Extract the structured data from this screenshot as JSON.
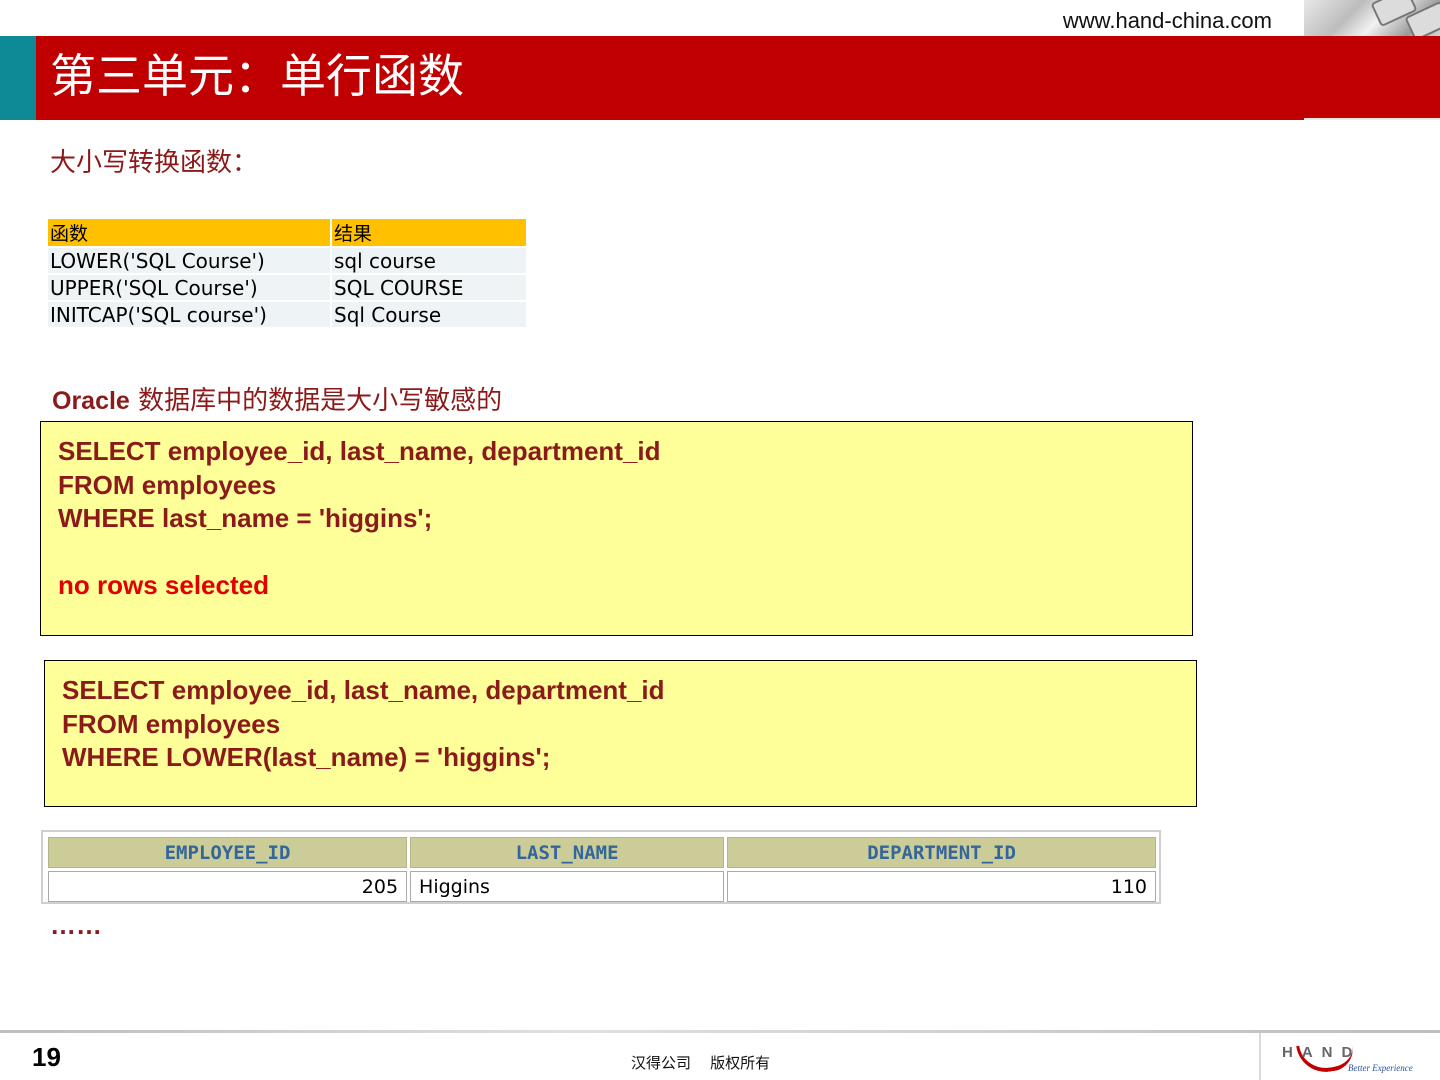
{
  "header": {
    "url": "www.hand-china.com",
    "title": "第三单元：单行函数"
  },
  "section": {
    "subheading": "大小写转换函数：",
    "func_table": {
      "headers": [
        "函数",
        "结果"
      ],
      "rows": [
        [
          "LOWER('SQL Course')",
          "sql course"
        ],
        [
          "UPPER('SQL Course')",
          "SQL COURSE"
        ],
        [
          "INITCAP('SQL course')",
          "Sql Course"
        ]
      ]
    },
    "note": {
      "bold": "Oracle",
      "rest": " 数据库中的数据是大小写敏感的"
    }
  },
  "query1": {
    "lines": [
      "SELECT employee_id, last_name, department_id",
      "FROM employees",
      "WHERE last_name = 'higgins';"
    ],
    "result": "no rows selected"
  },
  "query2": {
    "lines": [
      "SELECT employee_id, last_name, department_id",
      "FROM employees",
      "WHERE LOWER(last_name) = 'higgins';"
    ]
  },
  "result_table": {
    "headers": [
      "EMPLOYEE_ID",
      "LAST_NAME",
      "DEPARTMENT_ID"
    ],
    "rows": [
      [
        "205",
        "Higgins",
        "110"
      ]
    ]
  },
  "ellipsis": "……",
  "footer": {
    "page": "19",
    "copyright": "汉得公司    版权所有",
    "logo_word": "HAND",
    "logo_tagline": "Better Experience"
  },
  "colors": {
    "title_bar": "#c00000",
    "title_accent": "#0e8a97",
    "sql_box_bg": "#ffff99",
    "sql_text": "#8b1a1a",
    "table_header": "#ffc000"
  }
}
